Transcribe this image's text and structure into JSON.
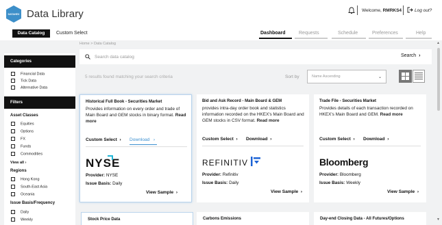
{
  "app": {
    "title": "Data Library",
    "logo_text": "DATAHEX"
  },
  "header": {
    "welcome_prefix": "Welcome, ",
    "username": "RMRKS4",
    "logout": "Log out?"
  },
  "nav": {
    "data_catalog": "Data Catalog",
    "custom_select": "Custom Select",
    "tabs": [
      {
        "label": "Dashboard",
        "active": true
      },
      {
        "label": "Requests",
        "active": false
      },
      {
        "label": "Schedule",
        "active": false
      },
      {
        "label": "Preferences",
        "active": false
      },
      {
        "label": "Help",
        "active": false
      }
    ]
  },
  "breadcrumb": "Home > Data Catalog",
  "search": {
    "placeholder": "Search data catalog",
    "button": "Search"
  },
  "results": {
    "text": "5 results found matching your search criteria",
    "sort_label": "Sort by",
    "sort_value": "Name Ascending"
  },
  "sidebar": {
    "categories_title": "Categories",
    "categories": [
      "Financial Data",
      "Tick Data",
      "Alternative Data"
    ],
    "filters_title": "Filters",
    "asset_classes_title": "Asset Classes",
    "asset_classes": [
      "Equities",
      "Options",
      "FX",
      "Funds",
      "Commodities"
    ],
    "view_all": "View all",
    "regions_title": "Regions",
    "regions": [
      "Hong Kong",
      "South-East Asia",
      "Oceania"
    ],
    "issue_title": "Issue Basis/Frequency",
    "issue": [
      "Daily",
      "Weekly"
    ]
  },
  "cards": [
    {
      "title": "Historical Full Book - Securities Market",
      "desc": "Provides information on every order and trade of Main Board and GEM stocks in binary format.",
      "read_more": "Read more",
      "custom_select": "Custom Select",
      "download": "Download",
      "logo": "NYSE",
      "provider_label": "Provider:",
      "provider": "NYSE",
      "issue_label": "Issue Basis:",
      "issue": "Daily",
      "view_sample": "View Sample"
    },
    {
      "title": "Bid and Ask Record - Main Board & GEM",
      "desc": "provides intra-day order book and statistics information recorded on the HKEX's Main Board and GEM stocks in CSV format.",
      "read_more": "Read more",
      "custom_select": "Custom Select",
      "download": "Download",
      "logo": "REFINITIV",
      "provider_label": "Provider:",
      "provider": "Refinitiv",
      "issue_label": "Issue Basis:",
      "issue": "Daily",
      "view_sample": "View Sample"
    },
    {
      "title": "Trade File - Securities Market",
      "desc": "Provides details of each transaction recorded on HKEX's Main Board and GEM.",
      "read_more": "Read more",
      "custom_select": "Custom Select",
      "download": "Download",
      "logo": "Bloomberg",
      "provider_label": "Provider:",
      "provider": "Bloomberg",
      "issue_label": "Issue Basis:",
      "issue": "Weekly",
      "view_sample": "View Sample"
    }
  ],
  "cards_row2": [
    "Stock Price Data",
    "Carbons Emissions",
    "Day-end Closing Data - All Futures/Options"
  ],
  "colors": {
    "accent": "#3a8fd0",
    "nyse": "#1fb5d6",
    "refinitiv": "#1e64d6",
    "logo": "#3d8fc9"
  },
  "icons": {
    "bell": "bell-icon",
    "logout": "logout-icon",
    "search": "search-icon",
    "chevron": "chevron-right-icon"
  }
}
